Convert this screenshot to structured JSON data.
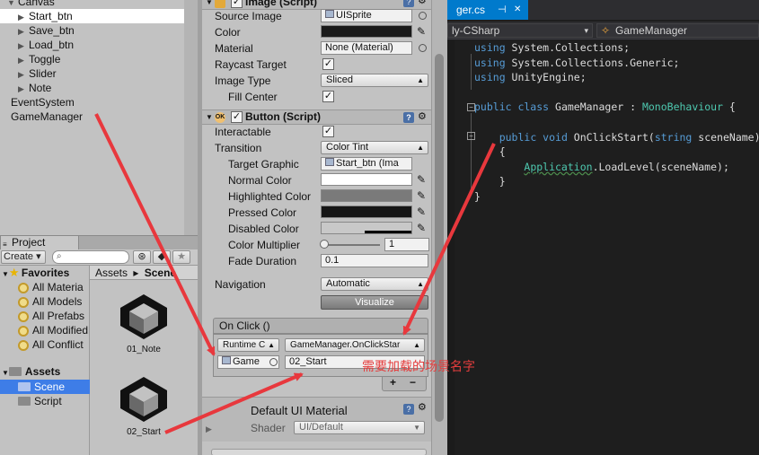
{
  "hierarchy": {
    "items": [
      {
        "label": "Canvas",
        "indent": 1,
        "arrow": "▼"
      },
      {
        "label": "Start_btn",
        "indent": 2,
        "arrow": "▶",
        "selected": true
      },
      {
        "label": "Save_btn",
        "indent": 2,
        "arrow": "▶"
      },
      {
        "label": "Load_btn",
        "indent": 2,
        "arrow": "▶"
      },
      {
        "label": "Toggle",
        "indent": 2,
        "arrow": "▶"
      },
      {
        "label": "Slider",
        "indent": 2,
        "arrow": "▶"
      },
      {
        "label": "Note",
        "indent": 2,
        "arrow": "▶"
      },
      {
        "label": "EventSystem",
        "indent": 1,
        "arrow": ""
      },
      {
        "label": "GameManager",
        "indent": 1,
        "arrow": ""
      }
    ]
  },
  "project": {
    "tab_label": "Project",
    "create_label": "Create ▾",
    "favorites": {
      "title": "Favorites",
      "items": [
        "All Materia",
        "All Models",
        "All Prefabs",
        "All Modified",
        "All Conflict"
      ]
    },
    "assets": {
      "title": "Assets",
      "items": [
        "Scene",
        "Script"
      ]
    },
    "breadcrumb": {
      "root": "Assets",
      "sep": "▸",
      "current": "Scene"
    },
    "asset_items": [
      "01_Note",
      "02_Start"
    ]
  },
  "inspector": {
    "image_component": {
      "title": "Image (Script)",
      "props": {
        "source_image_label": "Source Image",
        "source_image_value": "UISprite",
        "color_label": "Color",
        "material_label": "Material",
        "material_value": "None (Material)",
        "raycast_label": "Raycast Target",
        "raycast_checked": "✓",
        "image_type_label": "Image Type",
        "image_type_value": "Sliced",
        "fill_center_label": "Fill Center",
        "fill_center_checked": "✓"
      }
    },
    "button_component": {
      "title": "Button (Script)",
      "enabled_checked": "✓",
      "props": {
        "interactable_label": "Interactable",
        "interactable_checked": "✓",
        "transition_label": "Transition",
        "transition_value": "Color Tint",
        "target_graphic_label": "Target Graphic",
        "target_graphic_value": "Start_btn (Ima",
        "normal_label": "Normal Color",
        "highlighted_label": "Highlighted Color",
        "pressed_label": "Pressed Color",
        "disabled_label": "Disabled Color",
        "multiplier_label": "Color Multiplier",
        "multiplier_value": "1",
        "fade_label": "Fade Duration",
        "fade_value": "0.1",
        "navigation_label": "Navigation",
        "navigation_value": "Automatic",
        "visualize_label": "Visualize"
      },
      "onclick": {
        "header": "On Click ()",
        "runtime_value": "Runtime C",
        "function_value": "GameManager.OnClickStar",
        "object_value": "Game",
        "argument_value": "02_Start",
        "add_label": "+",
        "remove_label": "−"
      }
    },
    "material": {
      "name": "Default UI Material",
      "shader_label": "Shader",
      "shader_value": "UI/Default"
    },
    "colors": {
      "normal": "#ffffff",
      "highlighted": "#7a7a7a",
      "pressed": "#161616",
      "disabled": "#c8c8c8",
      "color": "#1a1a1a"
    }
  },
  "editor": {
    "tab_label": "ger.cs",
    "tab_pin": "⊣",
    "tab_close": "✕",
    "nav_left": "ly-CSharp",
    "nav_right": "GameManager",
    "code": [
      {
        "parts": [
          [
            "kw",
            "using"
          ],
          [
            "txt",
            " System.Collections;"
          ]
        ]
      },
      {
        "parts": [
          [
            "kw",
            "using"
          ],
          [
            "txt",
            " System.Collections.Generic;"
          ]
        ]
      },
      {
        "parts": [
          [
            "kw",
            "using"
          ],
          [
            "txt",
            " UnityEngine;"
          ]
        ]
      },
      {
        "parts": []
      },
      {
        "parts": [
          [
            "kw",
            "public class"
          ],
          [
            "txt",
            " GameManager : "
          ],
          [
            "ty",
            "MonoBehaviour"
          ],
          [
            "txt",
            " {"
          ]
        ]
      },
      {
        "parts": []
      },
      {
        "parts": [
          [
            "txt",
            "    "
          ],
          [
            "kw",
            "public void"
          ],
          [
            "txt",
            " OnClickStart("
          ],
          [
            "kw",
            "string"
          ],
          [
            "txt",
            " sceneName)"
          ]
        ]
      },
      {
        "parts": [
          [
            "txt",
            "    {"
          ]
        ]
      },
      {
        "parts": [
          [
            "txt",
            "        "
          ],
          [
            "ty",
            "Application"
          ],
          [
            "txt",
            ".LoadLevel(sceneName);"
          ]
        ]
      },
      {
        "parts": [
          [
            "txt",
            "    }"
          ]
        ]
      },
      {
        "parts": [
          [
            "txt",
            "}"
          ]
        ]
      }
    ]
  },
  "annotation": "需要加载的场景名字",
  "accent": "#3e7de7",
  "annotation_color": "#e53d3d"
}
